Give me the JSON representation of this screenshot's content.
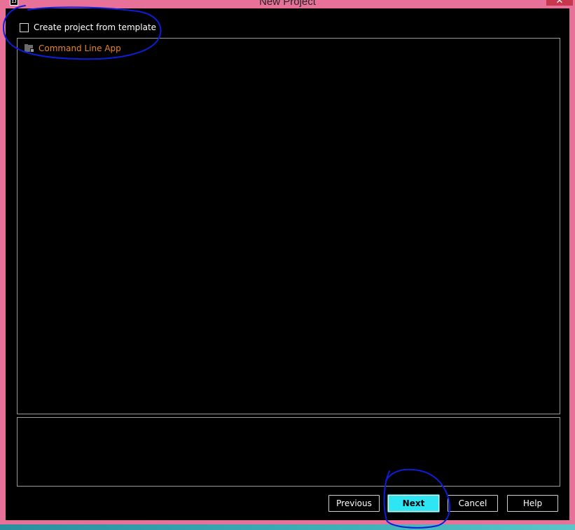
{
  "window": {
    "title": "New Project",
    "icon_text": "IJ",
    "close_glyph": "✕"
  },
  "template_checkbox": {
    "label": "Create project from template",
    "checked": false
  },
  "template_list": {
    "items": [
      {
        "label": "Command Line App",
        "icon": "folder-icon",
        "color": "#e8862a"
      }
    ]
  },
  "description": "",
  "buttons": {
    "previous": "Previous",
    "next": "Next",
    "cancel": "Cancel",
    "help": "Help"
  },
  "colors": {
    "window_frame": "#e8719a",
    "dialog_background": "#000000",
    "next_button": "#2ee6f3",
    "annotation_ink": "#0a1fd6"
  }
}
